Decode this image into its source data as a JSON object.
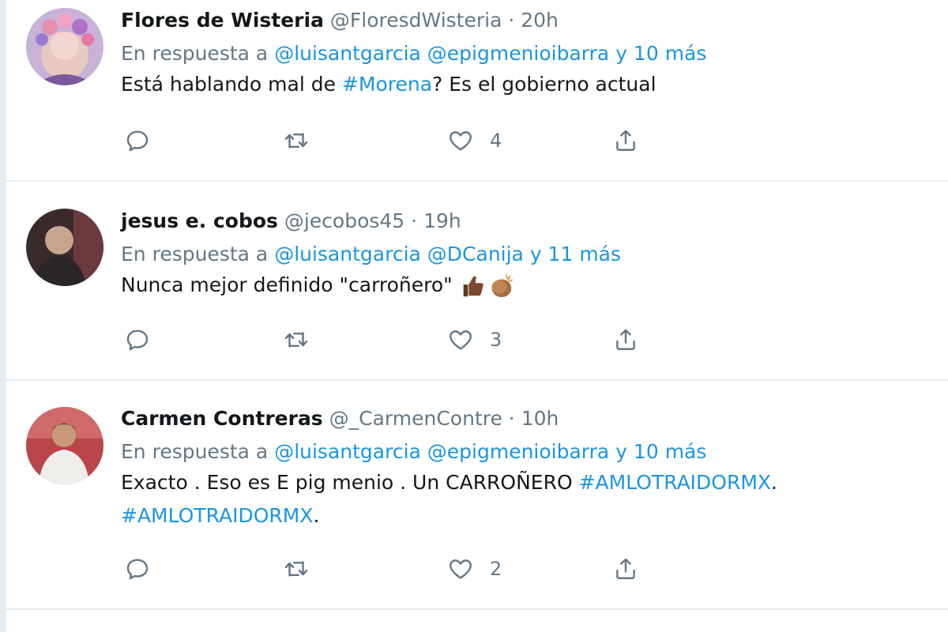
{
  "tweets": [
    {
      "name": "Flores de Wisteria",
      "handle": "@FloresdWisteria",
      "sep": " · ",
      "time": "20h",
      "reply_prefix": "En respuesta a ",
      "reply_users": "@luisantgarcia @epigmenioibarra y 10 más",
      "text_before": "Está hablando mal de ",
      "hashtag": "#Morena",
      "text_after": "? Es el gobierno actual",
      "likes": "4"
    },
    {
      "name": "jesus e. cobos",
      "handle": "@jecobos45",
      "sep": " · ",
      "time": "19h",
      "reply_prefix": "En respuesta a ",
      "reply_users": "@luisantgarcia @DCanija y 11 más",
      "text": "Nunca mejor definido \"carroñero\"",
      "emojis": [
        "thumbs-up",
        "clapping-hands"
      ],
      "likes": "3"
    },
    {
      "name": "Carmen Contreras",
      "handle": "@_CarmenContre",
      "sep": " · ",
      "time": "10h",
      "reply_prefix": "En respuesta a ",
      "reply_users": "@luisantgarcia @epigmenioibarra y 10 más",
      "text_before": "Exacto . Eso es E pig menio . Un CARROÑERO ",
      "hashtag1": "#AMLOTRAIDORMX",
      "text_mid": ".",
      "hashtag2": "#AMLOTRAIDORMX",
      "text_after": ".",
      "likes": "2"
    }
  ],
  "colors": {
    "link": "#1b95e0",
    "muted": "#657786",
    "text": "#14171a",
    "border": "#e6ecf0"
  },
  "icons": [
    "reply-icon",
    "retweet-icon",
    "like-icon",
    "share-icon"
  ]
}
